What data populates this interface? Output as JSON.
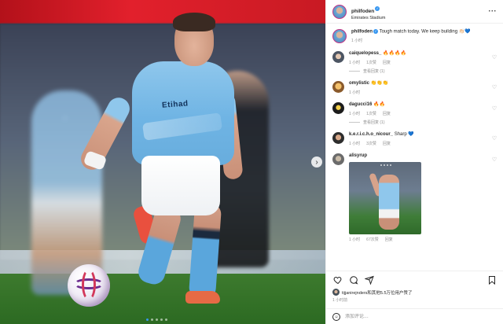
{
  "post": {
    "author": "philfoden",
    "location": "Emirates Stadium",
    "more_label": "···",
    "photo_sponsor_text": "Etihad",
    "carousel_total_slides": 5,
    "carousel_active_slide": 1
  },
  "caption": {
    "author": "philfoden",
    "text": "Tough match today. We keep building 👏🏻💙",
    "time": "1 小时"
  },
  "comments": [
    {
      "user": "caiquelopess_",
      "text": "🔥🔥🔥🔥",
      "time": "1 小时",
      "likes": "1次赞",
      "reply": "回复",
      "view_replies": "查看回复 (1)"
    },
    {
      "user": "omylistic",
      "text": "👏👏👏",
      "time": "1 小时"
    },
    {
      "user": "dagucci16",
      "text": "🔥🔥",
      "time": "1 小时",
      "likes": "1次赞",
      "reply": "回复",
      "view_replies": "查看回复 (1)"
    },
    {
      "user": "k.e.r.i.c.h.o_nicour_",
      "text": "Sharp 💙",
      "time": "1 小时",
      "likes": "3次赞",
      "reply": "回复"
    },
    {
      "user": "alisyrup",
      "text": "",
      "time": "1 小时",
      "likes": "67次赞",
      "reply": "回复"
    }
  ],
  "likes_summary": "tijjanirejnders和其他5.5万位用户赞了",
  "post_time": "1 小时前",
  "add_comment": {
    "placeholder": "添加评论..."
  },
  "icons": {
    "like": "heart-icon",
    "comment": "speech-bubble-icon",
    "share": "paper-plane-icon",
    "save": "bookmark-icon",
    "more": "ellipsis-icon",
    "next": "chevron-right-icon",
    "emoji": "smiley-icon"
  },
  "colors": {
    "accent": "#3897f0",
    "text": "#262626",
    "muted": "#8e8e8e",
    "border": "#efefef"
  }
}
